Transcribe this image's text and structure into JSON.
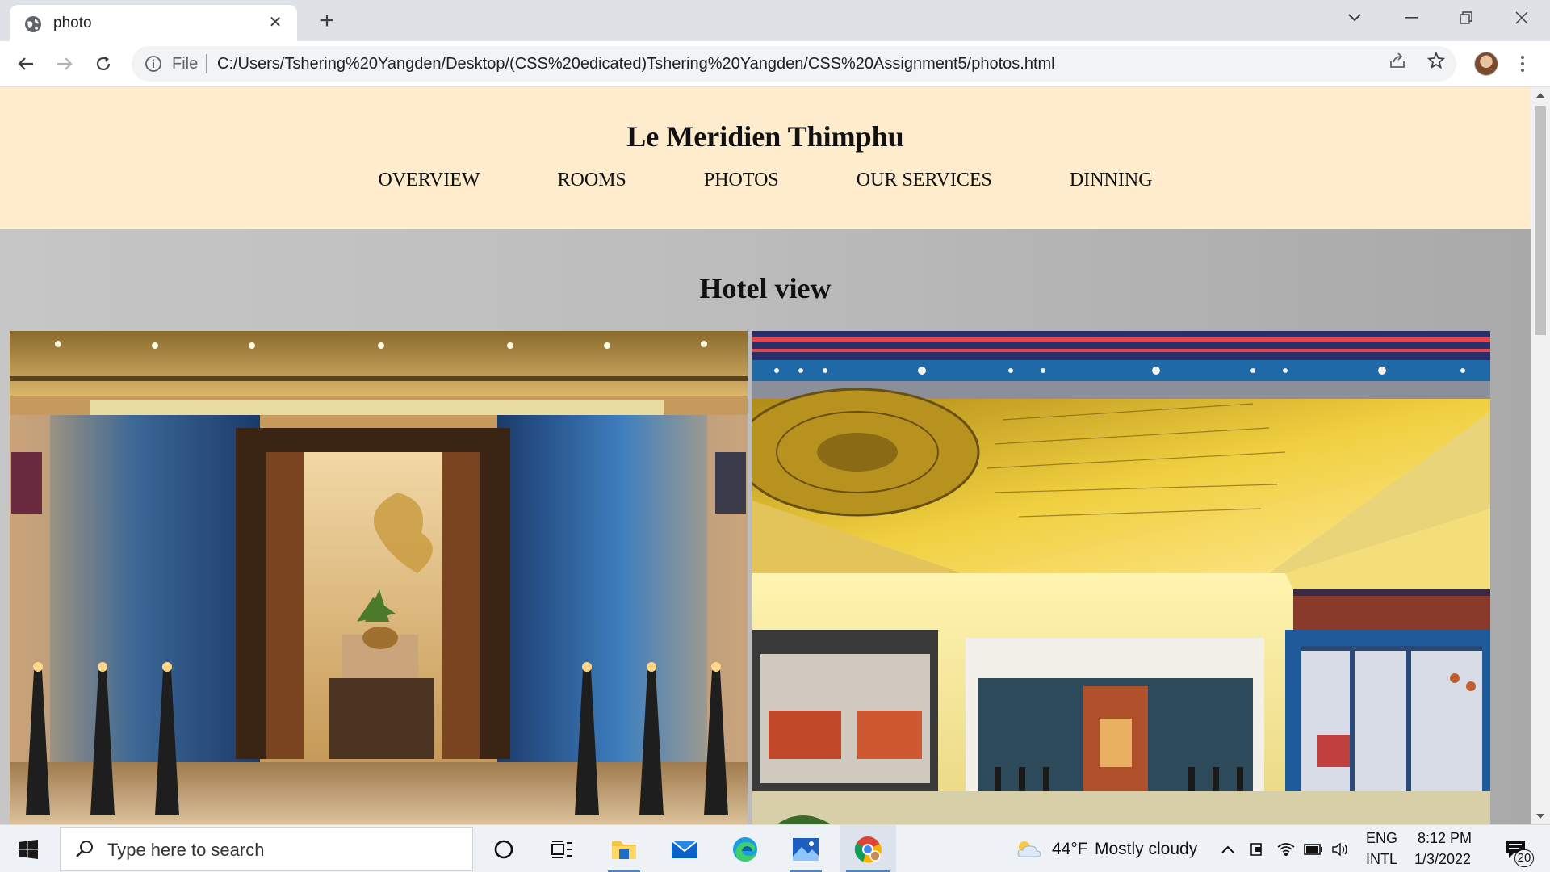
{
  "browser": {
    "tab_title": "photo",
    "address_prefix": "File",
    "url": "C:/Users/Tshering%20Yangden/Desktop/(CSS%20edicated)Tshering%20Yangden/CSS%20Assignment5/photos.html"
  },
  "page": {
    "site_title": "Le Meridien Thimphu",
    "nav": [
      "OVERVIEW",
      "ROOMS",
      "PHOTOS",
      "OUR SERVICES",
      "DINNING"
    ],
    "section_title": "Hotel view"
  },
  "taskbar": {
    "search_placeholder": "Type here to search",
    "weather_temp": "44°F",
    "weather_desc": "Mostly cloudy",
    "lang_line1": "ENG",
    "lang_line2": "INTL",
    "time": "8:12 PM",
    "date": "1/3/2022",
    "notification_count": "20"
  },
  "colors": {
    "header_bg": "#ffeccc",
    "gallery_bg": "#bdbdbd",
    "accent": "#4a86c8"
  }
}
